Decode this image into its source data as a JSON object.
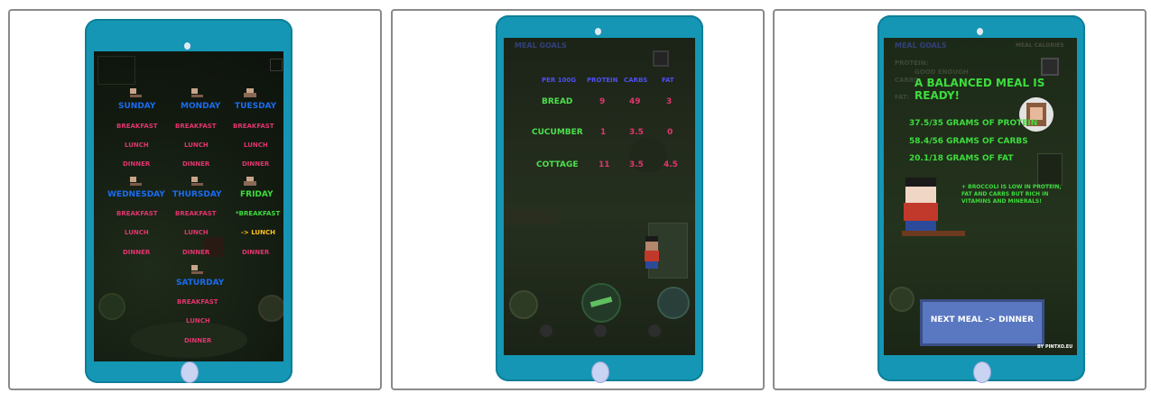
{
  "panel1": {
    "days": [
      {
        "name": "Sunday",
        "meals": [
          "Breakfast",
          "Lunch",
          "Dinner"
        ]
      },
      {
        "name": "Monday",
        "meals": [
          "Breakfast",
          "Lunch",
          "Dinner"
        ]
      },
      {
        "name": "Tuesday",
        "meals": [
          "Breakfast",
          "Lunch",
          "Dinner"
        ]
      },
      {
        "name": "Wednesday",
        "meals": [
          "Breakfast",
          "Lunch",
          "Dinner"
        ]
      },
      {
        "name": "Thursday",
        "meals": [
          "Breakfast",
          "Lunch",
          "Dinner"
        ]
      },
      {
        "name": "Friday",
        "meals": [
          "*Breakfast",
          "-> Lunch",
          "Dinner"
        ]
      },
      {
        "name": "Saturday",
        "meals": [
          "Breakfast",
          "Lunch",
          "Dinner"
        ]
      }
    ]
  },
  "panel2": {
    "header_dim": "Meal Goals",
    "columns": [
      "Per 100g",
      "Protein",
      "Carbs",
      "Fat"
    ],
    "rows": [
      {
        "food": "Bread",
        "protein": "9",
        "carbs": "49",
        "fat": "3"
      },
      {
        "food": "Cucumber",
        "protein": "1",
        "carbs": "3.5",
        "fat": "0"
      },
      {
        "food": "Cottage",
        "protein": "11",
        "carbs": "3.5",
        "fat": "4.5"
      }
    ]
  },
  "panel3": {
    "header_dim": "Meal Goals",
    "header_right_dim": "Meal Calories",
    "goal_labels_dim": [
      "Protein:",
      "Carbs:",
      "Fat:"
    ],
    "good_enough_dim": "Good enough",
    "title": "A balanced meal is ready!",
    "stats": [
      "37.5/35 grams of protein",
      "58.4/56 grams of carbs",
      "20.1/18 grams of fat"
    ],
    "note": "+ Broccoli is low in protein, fat and carbs but rich in vitamins and minerals!",
    "next_button": "Next meal -> Dinner",
    "credit": "by pintxo.eu"
  },
  "colors": {
    "tablet": "#1596b4",
    "day_blue": "#1a6cf0",
    "meal_pink": "#e0356e",
    "accent_green": "#3ddc3d",
    "current_yellow": "#ffc21a",
    "header_blue": "#4f4ff0",
    "button_fill": "#5a78c2"
  }
}
